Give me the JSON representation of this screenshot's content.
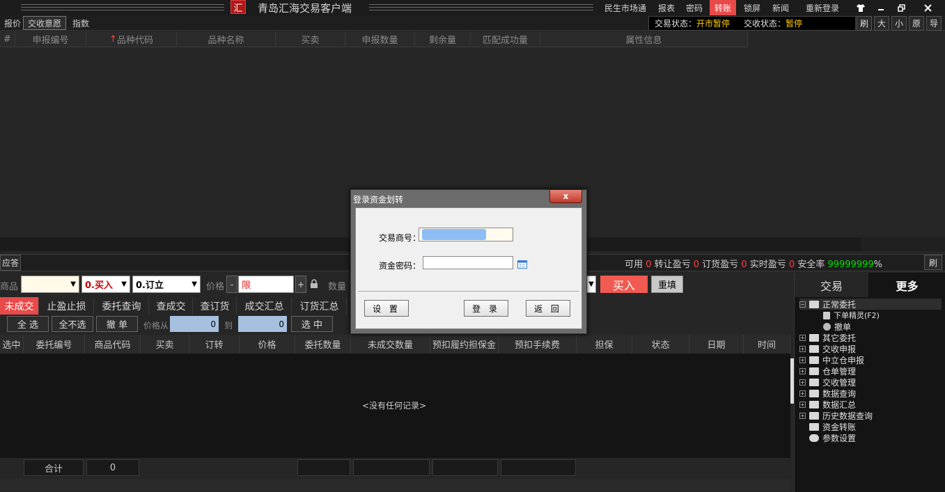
{
  "titlebar": {
    "logo_char": "汇",
    "title": "青岛汇海交易客户端",
    "nav": [
      "民生市场通",
      "报表",
      "密码",
      "转账",
      "锁屏",
      "新闻",
      "重新登录"
    ],
    "active_nav": "转账",
    "win_icons": [
      "shirt-icon",
      "minimize-icon",
      "restore-icon",
      "close-icon"
    ]
  },
  "bar2": {
    "tabs": [
      "报价",
      "交收意愿",
      "指数"
    ],
    "active_tab": "交收意愿",
    "status_label1": "交易状态：",
    "status_value1": "开市暂停",
    "status_label2": "交收状态：",
    "status_value2": "暂停",
    "size_buttons": [
      "刷",
      "大",
      "小",
      "原",
      "导"
    ]
  },
  "top_table": {
    "headers": [
      "#",
      "申报编号",
      "↑品种代码",
      "品种名称",
      "买卖",
      "申报数量",
      "剩余量",
      "匹配成功量",
      "属性信息"
    ]
  },
  "infobar": {
    "tab": "应答",
    "available_label": "可用",
    "available_value": "0",
    "transfer_pl_label": "转让盈亏",
    "transfer_pl_value": "0",
    "order_pl_label": "订货盈亏",
    "order_pl_value": "0",
    "realtime_pl_label": "实时盈亏",
    "realtime_pl_value": "0",
    "safety_label": "安全率",
    "safety_value": "99999999",
    "safety_unit": "%",
    "refresh": "刷"
  },
  "order_form": {
    "product_label": "商品",
    "product_value": "",
    "side_value": "0.买入",
    "open_value": "0.订立",
    "price_label": "价格",
    "minus": "-",
    "price_value": "限",
    "plus": "+",
    "qty_label": "数量",
    "buy_button": "买入",
    "reset_button": "重填"
  },
  "lower_tabs": [
    "未成交",
    "止盈止损",
    "委托查询",
    "查成交",
    "查订货",
    "成交汇总",
    "订货汇总"
  ],
  "active_lower_tab": "未成交",
  "action_bar": {
    "select_all": "全 选",
    "select_none": "全不选",
    "cancel": "撤 单",
    "price_from_label": "价格从",
    "price_from_value": "0",
    "to_label": "到",
    "price_to_value": "0",
    "select_mid": "选 中"
  },
  "lower_table": {
    "headers": [
      "选中",
      "委托编号",
      "商品代码",
      "买卖",
      "订转",
      "价格",
      "委托数量",
      "未成交数量",
      "预扣履约担保金",
      "预扣手续费",
      "担保",
      "状态",
      "日期",
      "时间"
    ],
    "empty_text": "<没有任何记录>",
    "total_label": "合计",
    "total_value": "0"
  },
  "right_panel": {
    "tabs": [
      "交易",
      "更多"
    ],
    "active_tab": "更多",
    "tree": [
      {
        "label": "正常委托",
        "expand": "−",
        "level": 0,
        "selected": true
      },
      {
        "label": "下单精灵(F2)",
        "expand": "",
        "level": 1
      },
      {
        "label": "撤单",
        "expand": "",
        "level": 1
      },
      {
        "label": "其它委托",
        "expand": "+",
        "level": 0
      },
      {
        "label": "交收申报",
        "expand": "+",
        "level": 0
      },
      {
        "label": "中立仓申报",
        "expand": "+",
        "level": 0
      },
      {
        "label": "仓单管理",
        "expand": "+",
        "level": 0
      },
      {
        "label": "交收管理",
        "expand": "+",
        "level": 0
      },
      {
        "label": "数据查询",
        "expand": "+",
        "level": 0
      },
      {
        "label": "数据汇总",
        "expand": "+",
        "level": 0
      },
      {
        "label": "历史数据查询",
        "expand": "+",
        "level": 0
      },
      {
        "label": "资金转账",
        "expand": "",
        "level": 0
      },
      {
        "label": "参数设置",
        "expand": "",
        "level": 0
      }
    ]
  },
  "dialog": {
    "title": "登录资金划转",
    "close": "x",
    "trader_label": "交易商号：",
    "trader_value": "",
    "password_label": "资金密码：",
    "password_value": "",
    "settings_button": "设 置",
    "login_button": "登 录",
    "back_button": "返 回"
  }
}
